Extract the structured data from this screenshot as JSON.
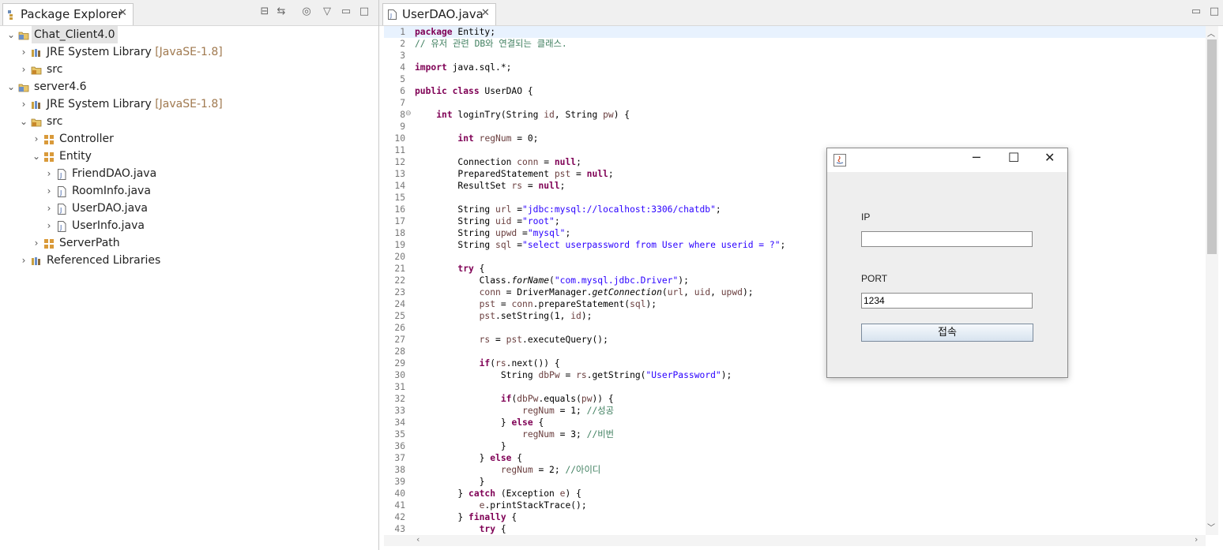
{
  "package_explorer": {
    "tab_title": "Package Explorer",
    "tree": [
      {
        "label": "Chat_Client4.0",
        "decoration": "",
        "icon": "project-icon",
        "expanded": true,
        "selected": true
      },
      {
        "label": "JRE System Library",
        "decoration": "[JavaSE-1.8]",
        "icon": "library-icon",
        "expanded": false
      },
      {
        "label": "src",
        "decoration": "",
        "icon": "source-folder-icon",
        "expanded": false
      },
      {
        "label": "server4.6",
        "decoration": "",
        "icon": "project-icon",
        "expanded": true
      },
      {
        "label": "JRE System Library",
        "decoration": "[JavaSE-1.8]",
        "icon": "library-icon",
        "expanded": false
      },
      {
        "label": "src",
        "decoration": "",
        "icon": "source-folder-icon",
        "expanded": true
      },
      {
        "label": "Controller",
        "decoration": "",
        "icon": "package-icon",
        "expanded": false
      },
      {
        "label": "Entity",
        "decoration": "",
        "icon": "package-icon",
        "expanded": true
      },
      {
        "label": "FriendDAO.java",
        "decoration": "",
        "icon": "java-file-icon",
        "expanded": false
      },
      {
        "label": "RoomInfo.java",
        "decoration": "",
        "icon": "java-file-icon",
        "expanded": false
      },
      {
        "label": "UserDAO.java",
        "decoration": "",
        "icon": "java-file-icon",
        "expanded": false
      },
      {
        "label": "UserInfo.java",
        "decoration": "",
        "icon": "java-file-icon",
        "expanded": false
      },
      {
        "label": "ServerPath",
        "decoration": "",
        "icon": "package-icon",
        "expanded": false
      },
      {
        "label": "Referenced Libraries",
        "decoration": "",
        "icon": "library-icon",
        "expanded": false
      }
    ]
  },
  "editor": {
    "tab_title": "UserDAO.java",
    "lines": [
      {
        "n": "1",
        "html": "<span class='kw'>package</span> Entity;"
      },
      {
        "n": "2",
        "html": "<span class='cmt'>// 유저 관련 DB와 연결되는 클래스.</span>"
      },
      {
        "n": "3",
        "html": ""
      },
      {
        "n": "4",
        "html": "<span class='kw'>import</span> java.sql.*;"
      },
      {
        "n": "5",
        "html": ""
      },
      {
        "n": "6",
        "html": "<span class='kw'>public class</span> UserDAO {"
      },
      {
        "n": "7",
        "html": ""
      },
      {
        "n": "8",
        "html": "    <span class='kw'>int</span> loginTry(String <span class='var'>id</span>, String <span class='var'>pw</span>) {"
      },
      {
        "n": "9",
        "html": ""
      },
      {
        "n": "10",
        "html": "        <span class='kw'>int</span> <span class='var'>regNum</span> = 0;"
      },
      {
        "n": "11",
        "html": ""
      },
      {
        "n": "12",
        "html": "        Connection <span class='var'>conn</span> = <span class='kw'>null</span>;"
      },
      {
        "n": "13",
        "html": "        PreparedStatement <span class='var'>pst</span> = <span class='kw'>null</span>;"
      },
      {
        "n": "14",
        "html": "        ResultSet <span class='var'>rs</span> = <span class='kw'>null</span>;"
      },
      {
        "n": "15",
        "html": ""
      },
      {
        "n": "16",
        "html": "        String <span class='var'>url</span> =<span class='str'>\"jdbc:mysql://localhost:3306/chatdb\"</span>;"
      },
      {
        "n": "17",
        "html": "        String <span class='var'>uid</span> =<span class='str'>\"root\"</span>;"
      },
      {
        "n": "18",
        "html": "        String <span class='var'>upwd</span> =<span class='str'>\"mysql\"</span>;"
      },
      {
        "n": "19",
        "html": "        String <span class='var'>sql</span> =<span class='str'>\"select userpassword from User where userid = ?\"</span>;"
      },
      {
        "n": "20",
        "html": ""
      },
      {
        "n": "21",
        "html": "        <span class='kw'>try</span> {"
      },
      {
        "n": "22",
        "html": "            Class.<span class='it'>forName</span>(<span class='str'>\"com.mysql.jdbc.Driver\"</span>);"
      },
      {
        "n": "23",
        "html": "            <span class='var'>conn</span> = DriverManager.<span class='it'>getConnection</span>(<span class='var'>url</span>, <span class='var'>uid</span>, <span class='var'>upwd</span>);"
      },
      {
        "n": "24",
        "html": "            <span class='var'>pst</span> = <span class='var'>conn</span>.prepareStatement(<span class='var'>sql</span>);"
      },
      {
        "n": "25",
        "html": "            <span class='var'>pst</span>.setString(1, <span class='var'>id</span>);"
      },
      {
        "n": "26",
        "html": ""
      },
      {
        "n": "27",
        "html": "            <span class='var'>rs</span> = <span class='var'>pst</span>.executeQuery();"
      },
      {
        "n": "28",
        "html": ""
      },
      {
        "n": "29",
        "html": "            <span class='kw'>if</span>(<span class='var'>rs</span>.next()) {"
      },
      {
        "n": "30",
        "html": "                String <span class='var'>dbPw</span> = <span class='var'>rs</span>.getString(<span class='str'>\"UserPassword\"</span>);"
      },
      {
        "n": "31",
        "html": ""
      },
      {
        "n": "32",
        "html": "                <span class='kw'>if</span>(<span class='var'>dbPw</span>.equals(<span class='var'>pw</span>)) {"
      },
      {
        "n": "33",
        "html": "                    <span class='var'>regNum</span> = 1; <span class='cmt'>//성공</span>"
      },
      {
        "n": "34",
        "html": "                } <span class='kw'>else</span> {"
      },
      {
        "n": "35",
        "html": "                    <span class='var'>regNum</span> = 3; <span class='cmt'>//비번</span>"
      },
      {
        "n": "36",
        "html": "                }"
      },
      {
        "n": "37",
        "html": "            } <span class='kw'>else</span> {"
      },
      {
        "n": "38",
        "html": "                <span class='var'>regNum</span> = 2; <span class='cmt'>//아이디</span>"
      },
      {
        "n": "39",
        "html": "            }"
      },
      {
        "n": "40",
        "html": "        } <span class='kw'>catch</span> (Exception <span class='var'>e</span>) {"
      },
      {
        "n": "41",
        "html": "            <span class='var'>e</span>.printStackTrace();"
      },
      {
        "n": "42",
        "html": "        } <span class='kw'>finally</span> {"
      },
      {
        "n": "43",
        "html": "            <span class='kw'>try</span> {"
      }
    ]
  },
  "dialog": {
    "ip_label": "IP",
    "ip_value": "",
    "port_label": "PORT",
    "port_value": "1234",
    "connect_label": "접속"
  },
  "colors": {
    "keyword": "#7f0055",
    "string": "#2a00ff",
    "comment": "#3f7f5f",
    "variable": "#6a3e3e",
    "decoration": "#a0794f"
  }
}
